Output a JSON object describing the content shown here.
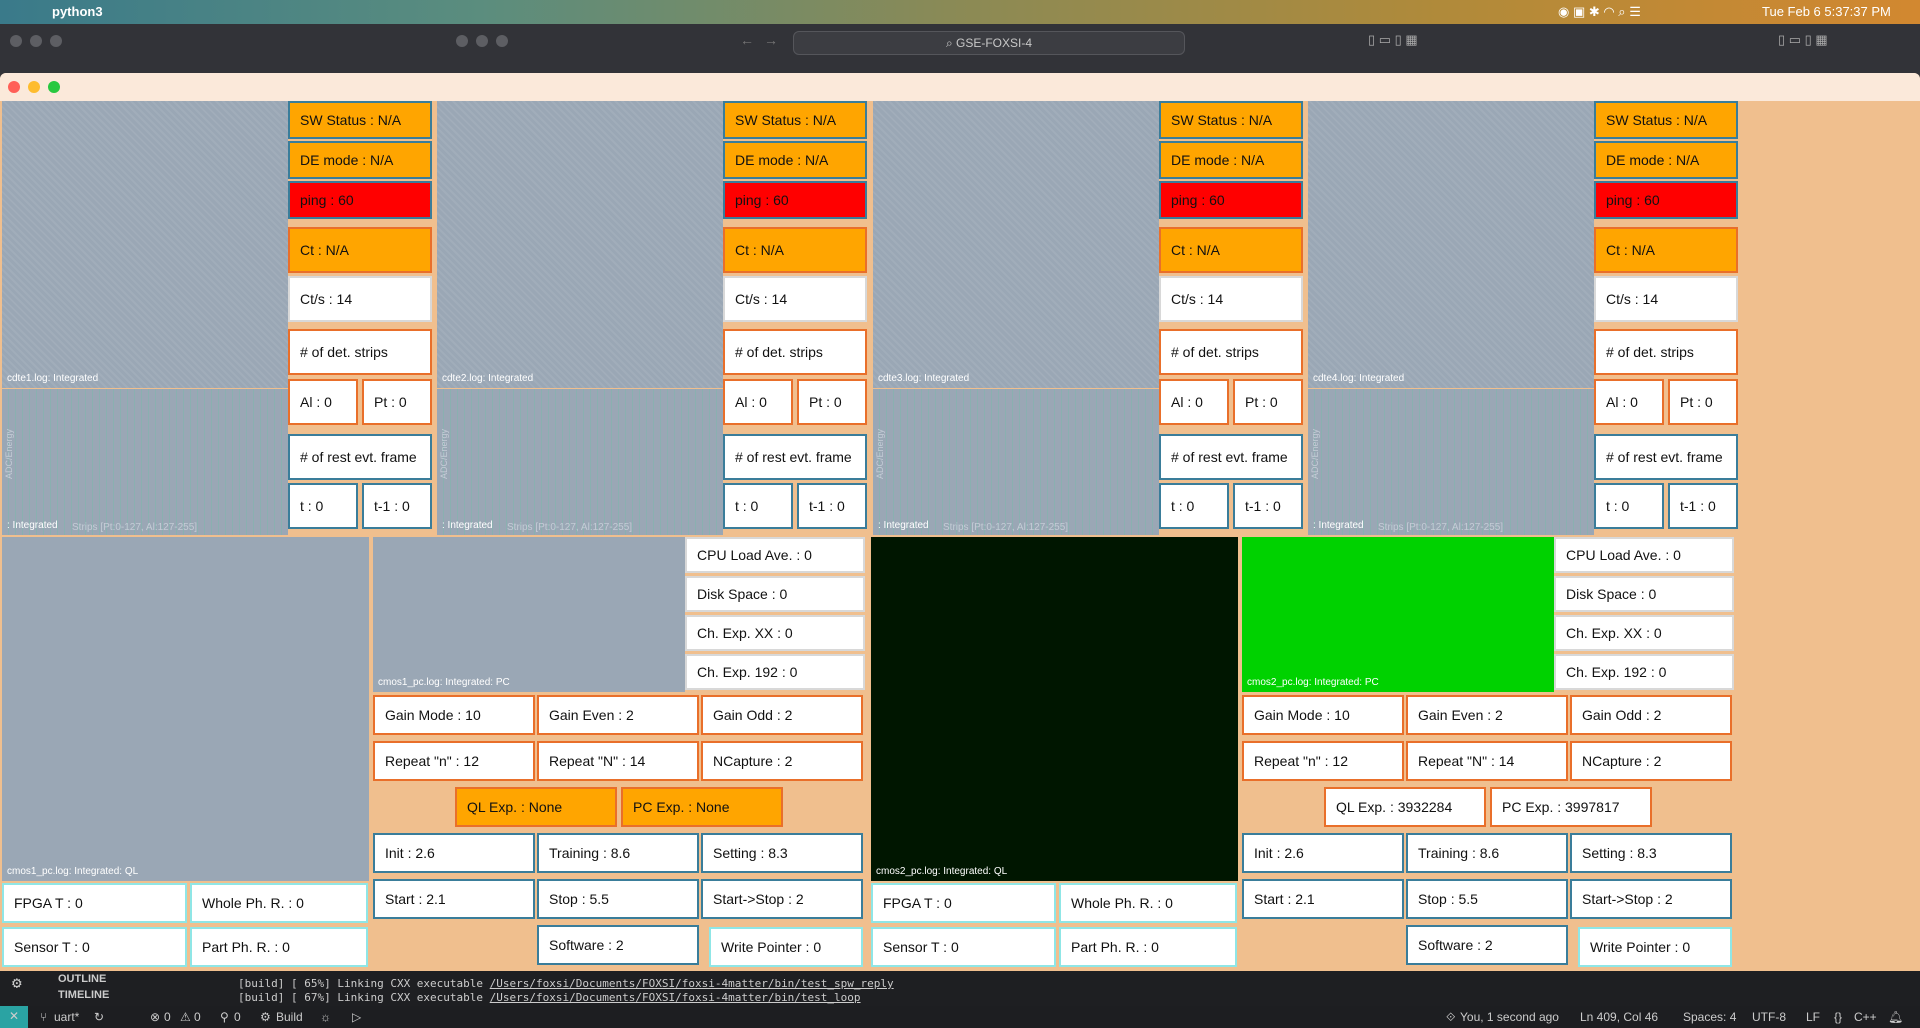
{
  "menubar": {
    "app": "python3",
    "date": "Tue Feb 6  5:37:37 PM"
  },
  "bgwindow": {
    "search": "GSE-FOXSI-4"
  },
  "cdte": [
    {
      "label": "cdte1.log: Integrated",
      "strips_label": ": Integrated",
      "strips_axis": "Strips [Pt:0-127, Al:127-255]",
      "y_axis": "ADC/Energy",
      "sw": "SW Status : N/A",
      "de": "DE mode : N/A",
      "ping": "ping : 60",
      "ct": "Ct : N/A",
      "cts": "Ct/s : 14",
      "det": "# of det. strips",
      "al": "Al : 0",
      "pt": "Pt : 0",
      "rest": "# of rest evt. frame",
      "t": "t : 0",
      "t1": "t-1 : 0"
    },
    {
      "label": "cdte2.log: Integrated",
      "strips_label": ": Integrated",
      "strips_axis": "Strips [Pt:0-127, Al:127-255]",
      "y_axis": "ADC/Energy",
      "sw": "SW Status : N/A",
      "de": "DE mode : N/A",
      "ping": "ping : 60",
      "ct": "Ct : N/A",
      "cts": "Ct/s : 14",
      "det": "# of det. strips",
      "al": "Al : 0",
      "pt": "Pt : 0",
      "rest": "# of rest evt. frame",
      "t": "t : 0",
      "t1": "t-1 : 0"
    },
    {
      "label": "cdte3.log: Integrated",
      "strips_label": ": Integrated",
      "strips_axis": "Strips [Pt:0-127, Al:127-255]",
      "y_axis": "ADC/Energy",
      "sw": "SW Status : N/A",
      "de": "DE mode : N/A",
      "ping": "ping : 60",
      "ct": "Ct : N/A",
      "cts": "Ct/s : 14",
      "det": "# of det. strips",
      "al": "Al : 0",
      "pt": "Pt : 0",
      "rest": "# of rest evt. frame",
      "t": "t : 0",
      "t1": "t-1 : 0"
    },
    {
      "label": "cdte4.log: Integrated",
      "strips_label": ": Integrated",
      "strips_axis": "Strips [Pt:0-127, Al:127-255]",
      "y_axis": "ADC/Energy",
      "sw": "SW Status : N/A",
      "de": "DE mode : N/A",
      "ping": "ping : 60",
      "ct": "Ct : N/A",
      "cts": "Ct/s : 14",
      "det": "# of det. strips",
      "al": "Al : 0",
      "pt": "Pt : 0",
      "rest": "# of rest evt. frame",
      "t": "t : 0",
      "t1": "t-1 : 0"
    }
  ],
  "cmos": [
    {
      "ql_label": "cmos1_pc.log: Integrated: QL",
      "pc_label": "cmos1_pc.log: Integrated: PC",
      "cpu": "CPU Load Ave. : 0",
      "disk": "Disk Space : 0",
      "chxx": "Ch. Exp. XX : 0",
      "ch192": "Ch. Exp. 192 : 0",
      "gain_mode": "Gain Mode : 10",
      "gain_even": "Gain Even : 2",
      "gain_odd": "Gain Odd : 2",
      "repeat_n": "Repeat \"n\" : 12",
      "repeat_N": "Repeat \"N\" : 14",
      "ncapture": "NCapture : 2",
      "ql_exp": "QL Exp. : None",
      "pc_exp": "PC Exp. : None",
      "init": "Init : 2.6",
      "training": "Training : 8.6",
      "setting": "Setting : 8.3",
      "start": "Start : 2.1",
      "stop": "Stop : 5.5",
      "startstop": "Start->Stop : 2",
      "software": "Software : 2",
      "write": "Write Pointer : 0",
      "fpga": "FPGA T : 0",
      "whole": "Whole Ph. R. : 0",
      "sensor": "Sensor T : 0",
      "part": "Part Ph. R. : 0"
    },
    {
      "ql_label": "cmos2_pc.log: Integrated: QL",
      "pc_label": "cmos2_pc.log: Integrated: PC",
      "cpu": "CPU Load Ave. : 0",
      "disk": "Disk Space : 0",
      "chxx": "Ch. Exp. XX : 0",
      "ch192": "Ch. Exp. 192 : 0",
      "gain_mode": "Gain Mode : 10",
      "gain_even": "Gain Even : 2",
      "gain_odd": "Gain Odd : 2",
      "repeat_n": "Repeat \"n\" : 12",
      "repeat_N": "Repeat \"N\" : 14",
      "ncapture": "NCapture : 2",
      "ql_exp": "QL Exp. : 3932284",
      "pc_exp": "PC Exp. : 3997817",
      "init": "Init : 2.6",
      "training": "Training : 8.6",
      "setting": "Setting : 8.3",
      "start": "Start : 2.1",
      "stop": "Stop : 5.5",
      "startstop": "Start->Stop : 2",
      "software": "Software : 2",
      "write": "Write Pointer : 0",
      "fpga": "FPGA T : 0",
      "whole": "Whole Ph. R. : 0",
      "sensor": "Sensor T : 0",
      "part": "Part Ph. R. : 0"
    }
  ],
  "terminal": {
    "outline": "OUTLINE",
    "timeline": "TIMELINE",
    "line1_prefix": "[build] [ 65%] Linking CXX executable ",
    "line1_path": "/Users/foxsi/Documents/FOXSI/foxsi-4matter/bin/test_spw_reply",
    "line2_prefix": "[build] [ 67%] Linking CXX executable ",
    "line2_path": "/Users/foxsi/Documents/FOXSI/foxsi-4matter/bin/test_loop"
  },
  "statusbar": {
    "branch": "uart*",
    "errors": "0",
    "warnings": "0",
    "ports": "0",
    "build": "Build",
    "blame": "You, 1 second ago",
    "position": "Ln 409, Col 46",
    "spaces": "Spaces: 4",
    "encoding": "UTF-8",
    "eol": "LF",
    "language": "C++"
  }
}
